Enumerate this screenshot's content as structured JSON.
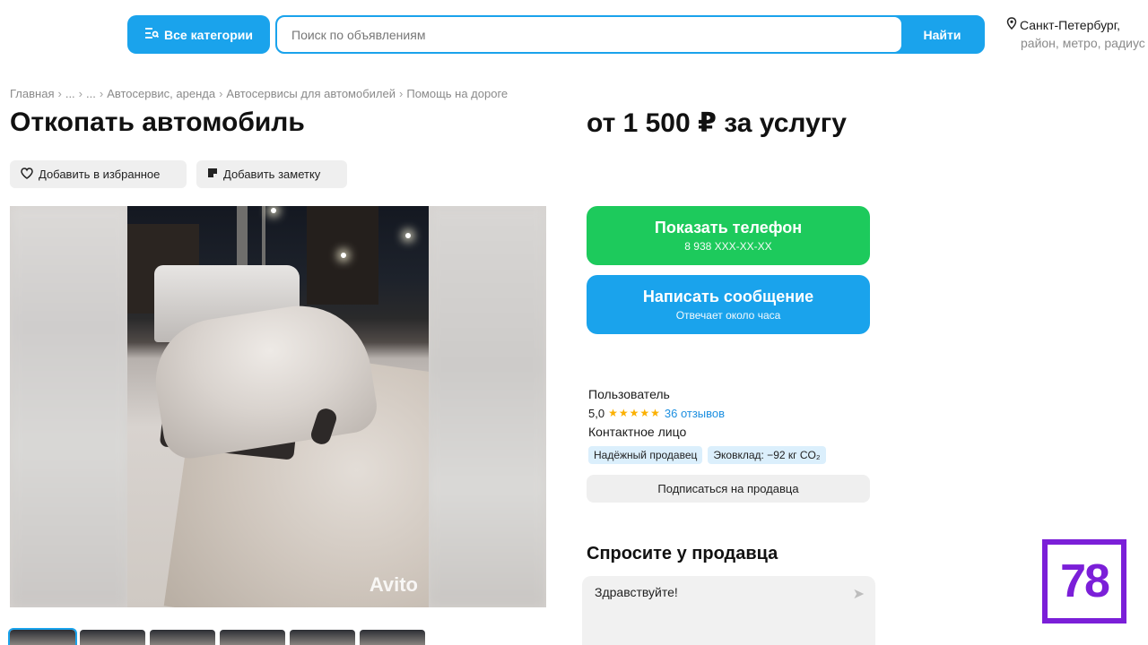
{
  "header": {
    "categories_label": "Все категории",
    "search_placeholder": "Поиск по объявлениям",
    "search_button": "Найти",
    "location_city": "Санкт-Петербург,",
    "location_sub": "район, метро, радиус"
  },
  "breadcrumbs": [
    "Главная",
    "...",
    "...",
    "Автосервис, аренда",
    "Автосервисы для автомобилей",
    "Помощь на дороге"
  ],
  "listing": {
    "title": "Откопать автомобиль",
    "price": "от 1 500 ₽ за услугу",
    "add_favorite": "Добавить в избранное",
    "add_note": "Добавить заметку",
    "watermark": "Avito"
  },
  "actions": {
    "show_phone": "Показать телефон",
    "phone_masked": "8 938 XXX-XX-XX",
    "write_message": "Написать сообщение",
    "response_time": "Отвечает около часа"
  },
  "seller": {
    "type": "Пользователь",
    "rating": "5,0",
    "stars": "★★★★★",
    "reviews": "36 отзывов",
    "contact": "Контактное лицо",
    "badges": [
      "Надёжный продавец",
      "Эковклад: −92 кг CO₂"
    ],
    "subscribe": "Подписаться на продавца"
  },
  "ask": {
    "title": "Спросите у продавца",
    "message": "Здравствуйте!"
  },
  "logo": "78",
  "colors": {
    "accent_blue": "#1aa3ec",
    "accent_green": "#1dca5c",
    "logo_purple": "#7b1fd8"
  }
}
